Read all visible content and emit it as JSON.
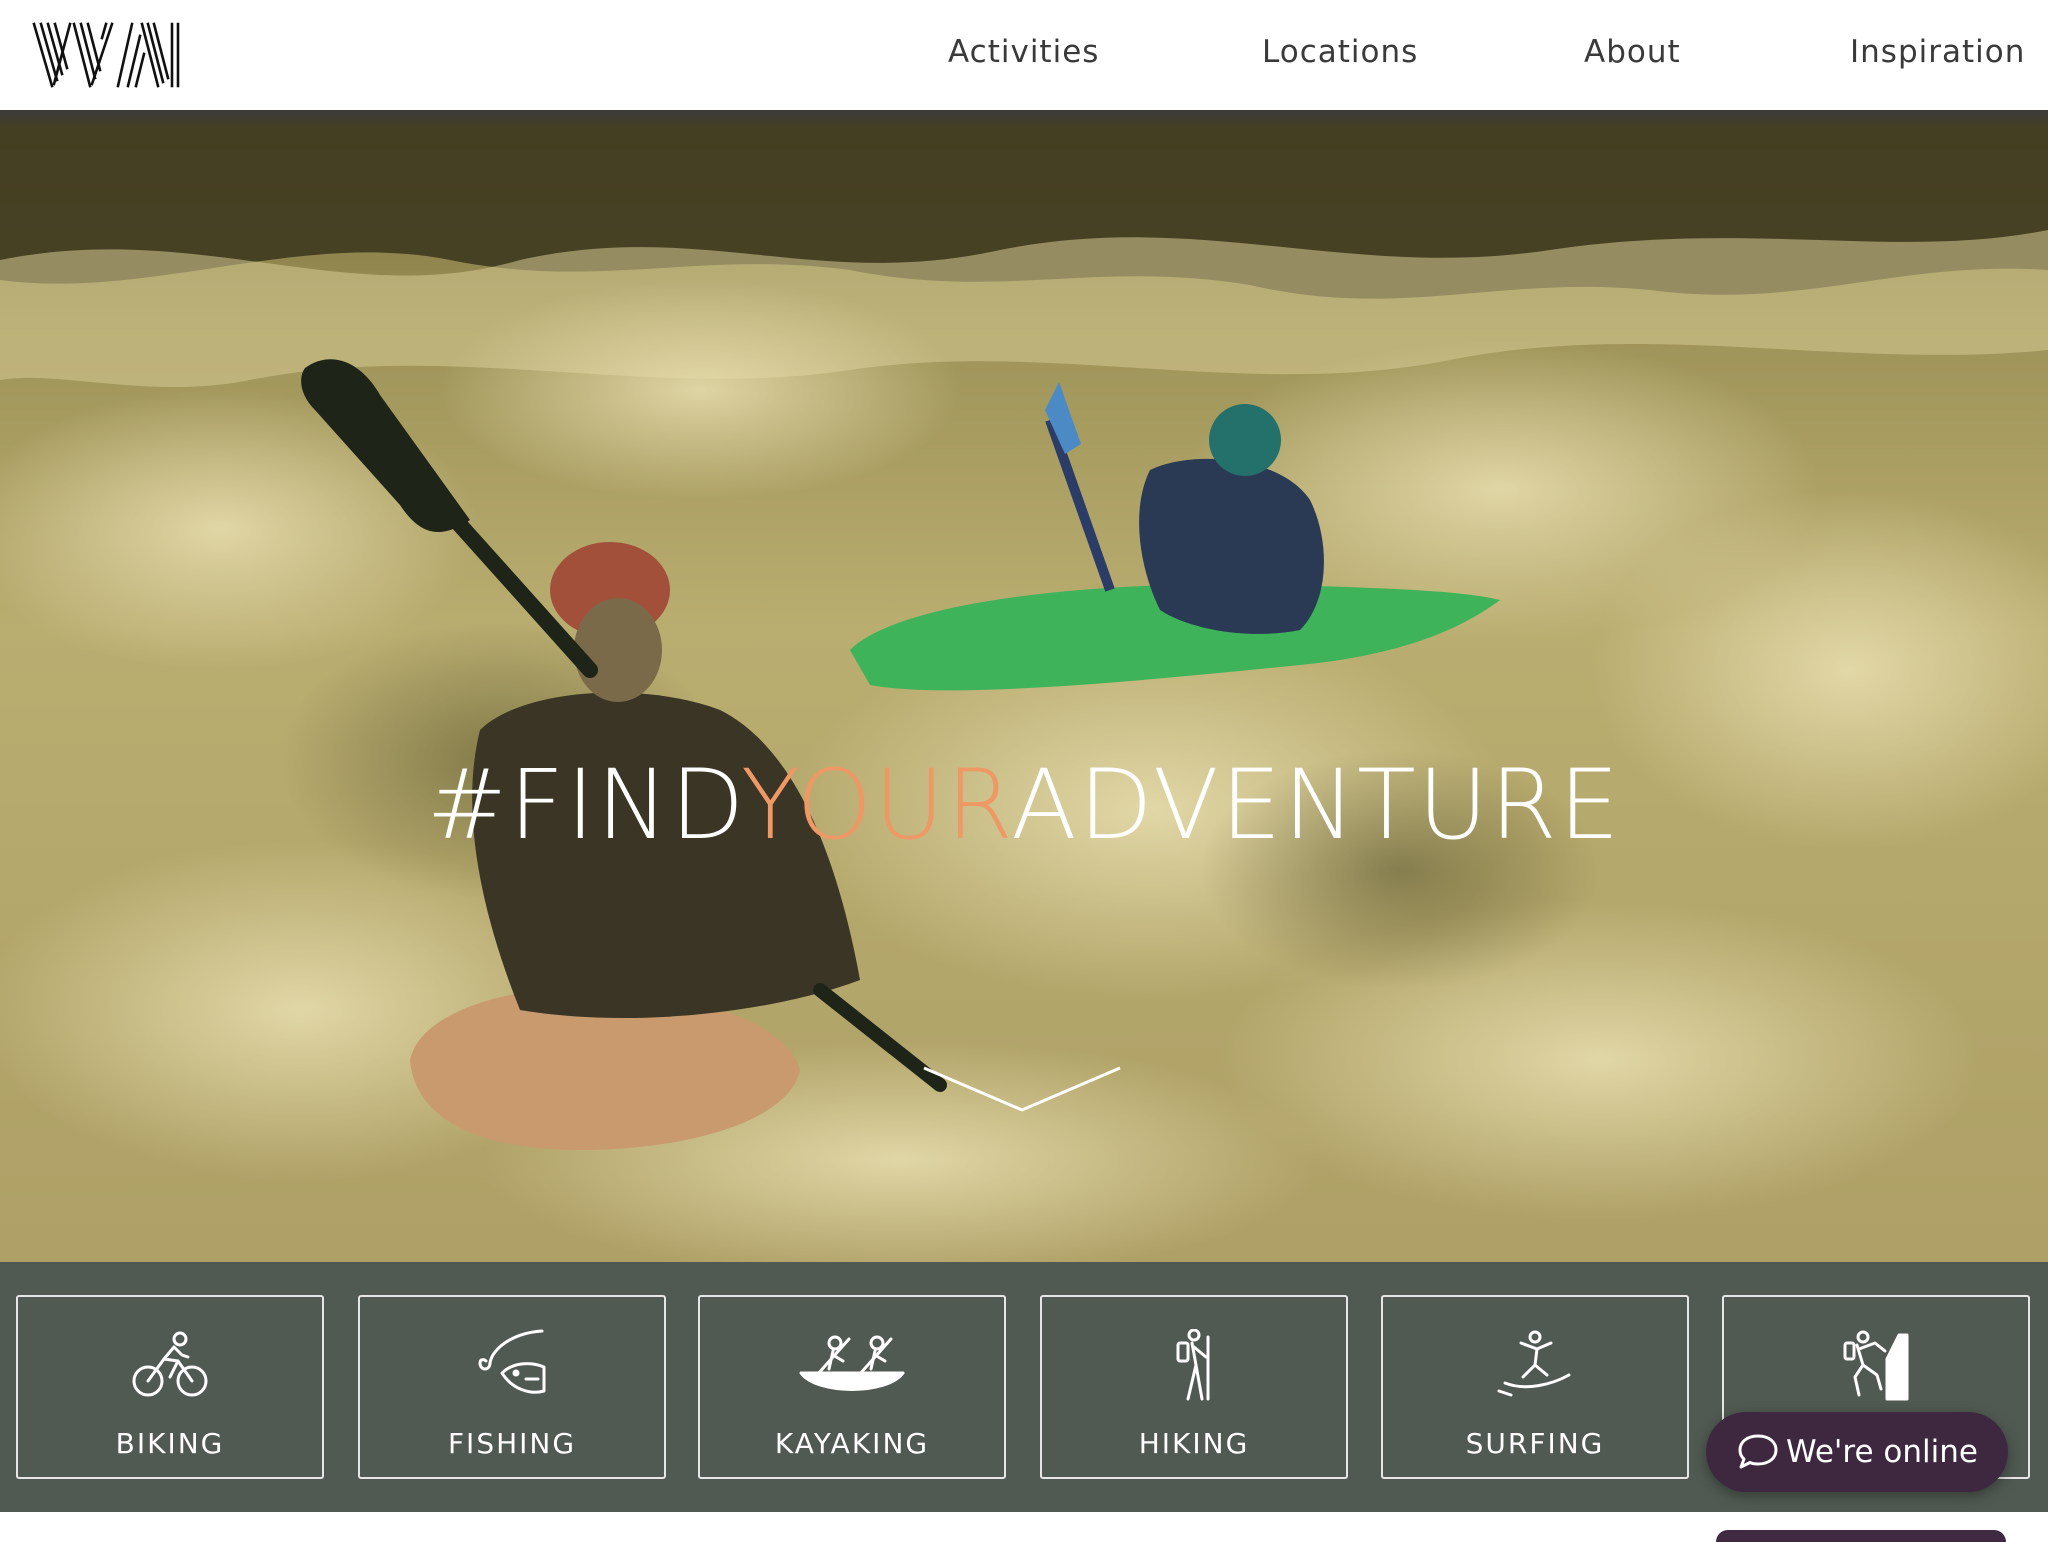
{
  "header": {
    "logo_text": "VVN",
    "nav": [
      {
        "label": "Activities"
      },
      {
        "label": "Locations"
      },
      {
        "label": "About"
      },
      {
        "label": "Inspiration"
      }
    ]
  },
  "hero": {
    "title_prefix": "#FIND",
    "title_accent": "YOUR",
    "title_suffix": "ADVENTURE",
    "accent_color": "#ee9866",
    "image_description": "two kayakers paddling through whitewater rapids",
    "scroll_icon": "chevron-down-icon"
  },
  "activities": [
    {
      "label": "BIKING",
      "icon": "bike-icon"
    },
    {
      "label": "FISHING",
      "icon": "fishing-icon"
    },
    {
      "label": "KAYAKING",
      "icon": "kayak-icon"
    },
    {
      "label": "HIKING",
      "icon": "hiker-icon"
    },
    {
      "label": "SURFING",
      "icon": "surfer-icon"
    },
    {
      "label": "",
      "icon": "climbing-icon"
    }
  ],
  "chat": {
    "label": "We're online",
    "icon": "chat-bubble-icon",
    "color": "#3d2840"
  },
  "colors": {
    "activity_bar": "#505a52",
    "nav_text": "#3a3a3a"
  }
}
